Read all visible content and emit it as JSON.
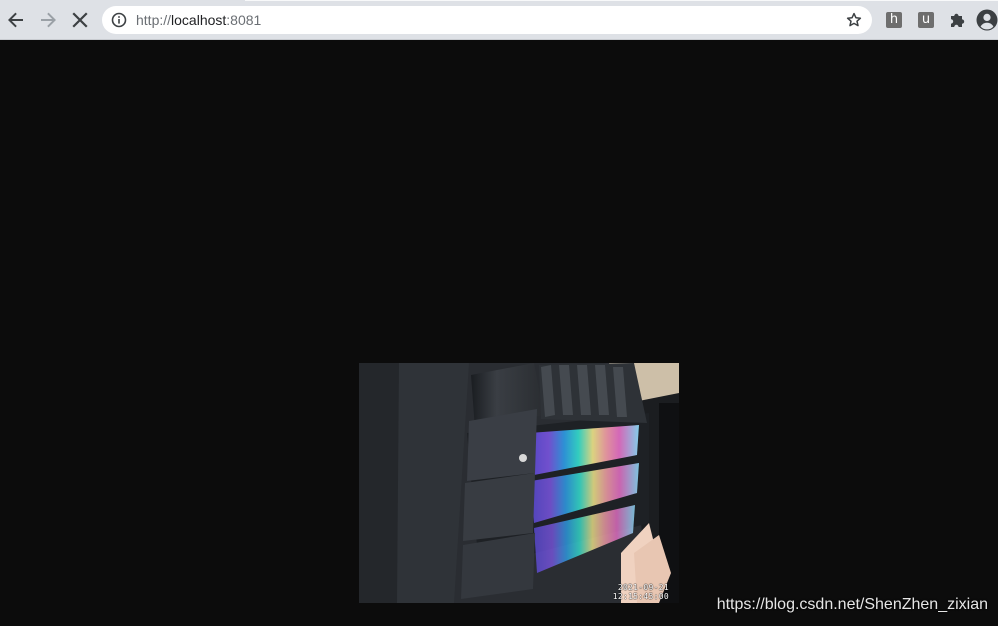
{
  "browser": {
    "address_bar": {
      "url_prefix": "http://",
      "url_host": "localhost",
      "url_port": ":8081"
    },
    "extensions": [
      {
        "label": "h"
      },
      {
        "label": "u"
      }
    ]
  },
  "page": {
    "camera_stream": {
      "timestamp_date": "2021-09-21",
      "timestamp_time": "12:15:45:00"
    }
  },
  "watermark": {
    "text": "https://blog.csdn.net/ShenZhen_zixian"
  },
  "colors": {
    "toolbar_bg": "#dee1e6",
    "page_bg": "#0c0c0c",
    "icon": "#3c4043"
  },
  "icons": {
    "back": "arrow-left-icon",
    "forward": "arrow-right-icon",
    "stop": "close-icon",
    "site_info": "info-icon",
    "bookmark": "star-icon",
    "extensions": "puzzle-icon",
    "profile": "account-circle-icon"
  }
}
